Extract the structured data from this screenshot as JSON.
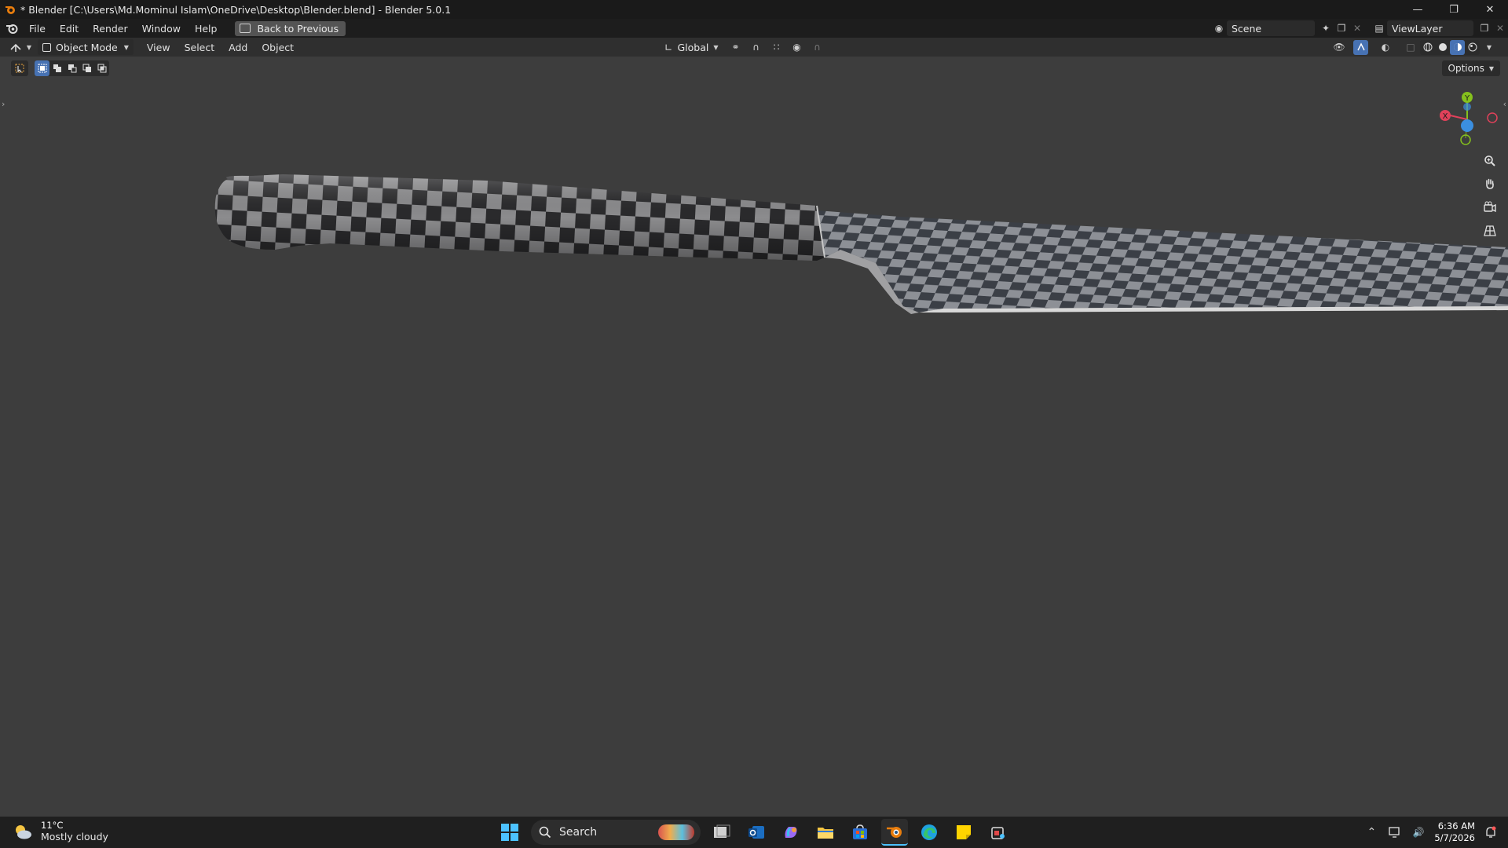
{
  "window": {
    "title": "* Blender [C:\\Users\\Md.Mominul Islam\\OneDrive\\Desktop\\Blender.blend] - Blender 5.0.1",
    "controls": [
      "minimize-icon",
      "restore-icon",
      "close-icon"
    ]
  },
  "menubar": {
    "items": [
      "File",
      "Edit",
      "Render",
      "Window",
      "Help"
    ],
    "back_label": "Back to Previous",
    "scene": "Scene",
    "view_layer": "ViewLayer"
  },
  "viewport_header": {
    "mode": "Object Mode",
    "menus": [
      "View",
      "Select",
      "Add",
      "Object"
    ],
    "transform_orientation": "Global",
    "shading_active": "solid"
  },
  "toolbar": {
    "options_label": "Options"
  },
  "gizmo": {
    "x_label": "X",
    "y_label": "Y"
  },
  "taskbar": {
    "weather_temp": "11°C",
    "weather_condition": "Mostly cloudy",
    "search_placeholder": "Search",
    "time": "6:36 AM",
    "date": "5/7/2026"
  },
  "colors": {
    "accent": "#4772b3",
    "viewport_bg": "#3d3d3d",
    "gizmo_x": "#e0415a",
    "gizmo_y": "#85c11d",
    "gizmo_z": "#3b8fe0"
  }
}
